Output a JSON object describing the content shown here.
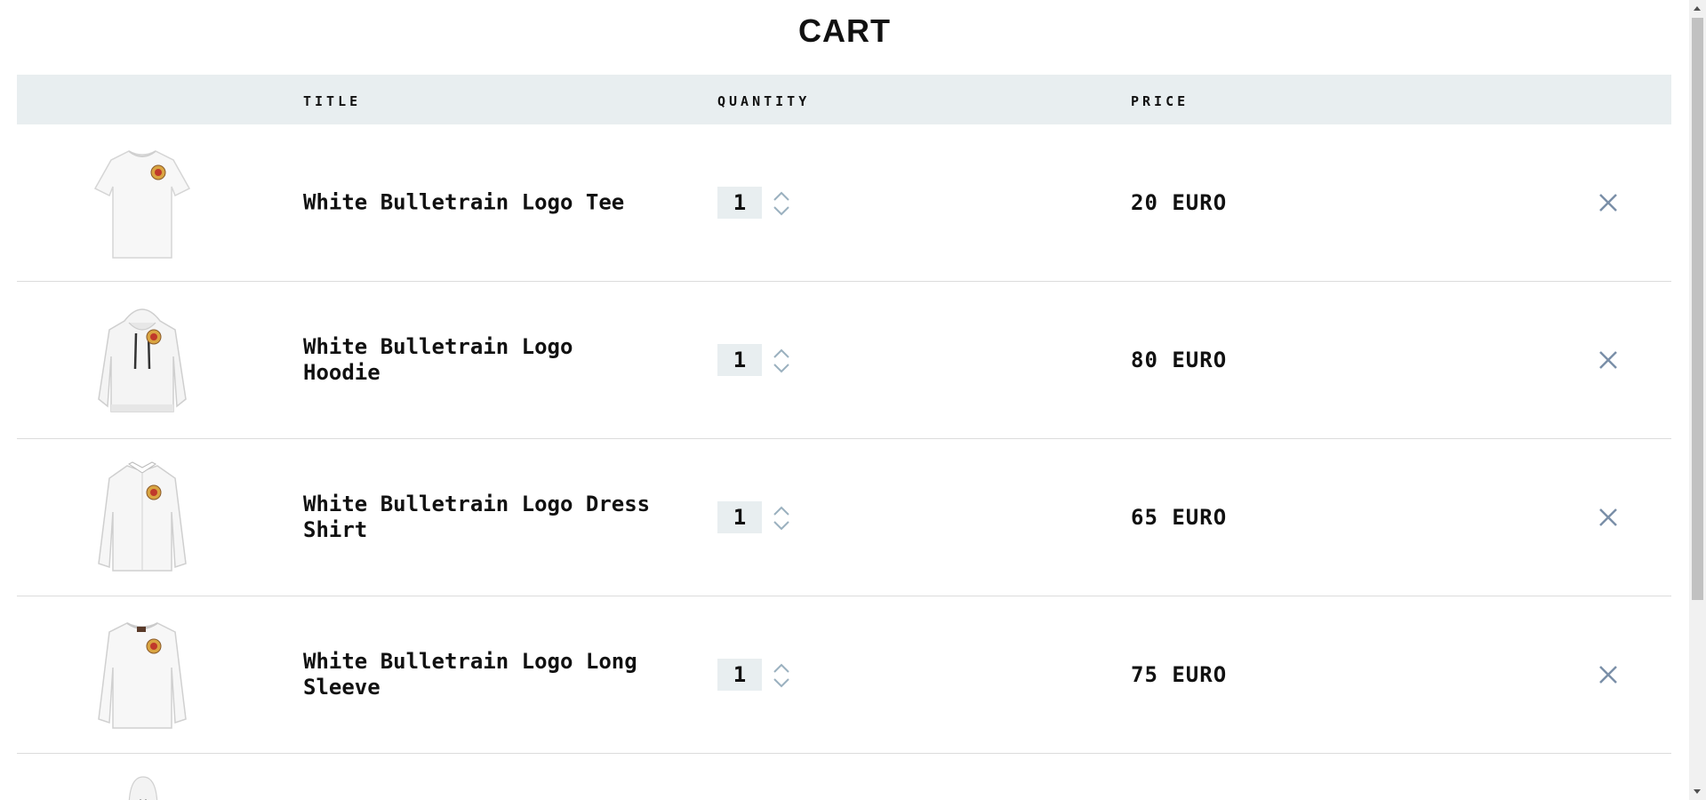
{
  "page": {
    "title": "CART"
  },
  "table": {
    "headers": {
      "title": "TITLE",
      "quantity": "QUANTITY",
      "price": "PRICE"
    },
    "items": [
      {
        "title": "White Bulletrain Logo Tee",
        "quantity": "1",
        "price": "20 EURO",
        "image": "tee-image"
      },
      {
        "title": "White Bulletrain Logo Hoodie",
        "quantity": "1",
        "price": "80 EURO",
        "image": "hoodie-image"
      },
      {
        "title": "White Bulletrain Logo Dress Shirt",
        "quantity": "1",
        "price": "65 EURO",
        "image": "dress-shirt-image"
      },
      {
        "title": "White Bulletrain Logo Long Sleeve",
        "quantity": "1",
        "price": "75 EURO",
        "image": "long-sleeve-image"
      }
    ]
  },
  "colors": {
    "header_bg": "#e8eef0",
    "icon_color": "#7a8fa8",
    "stepper_color": "#9ab0bf"
  },
  "icons": {
    "remove": "close-icon",
    "increment": "chevron-up-icon",
    "decrement": "chevron-down-icon"
  }
}
